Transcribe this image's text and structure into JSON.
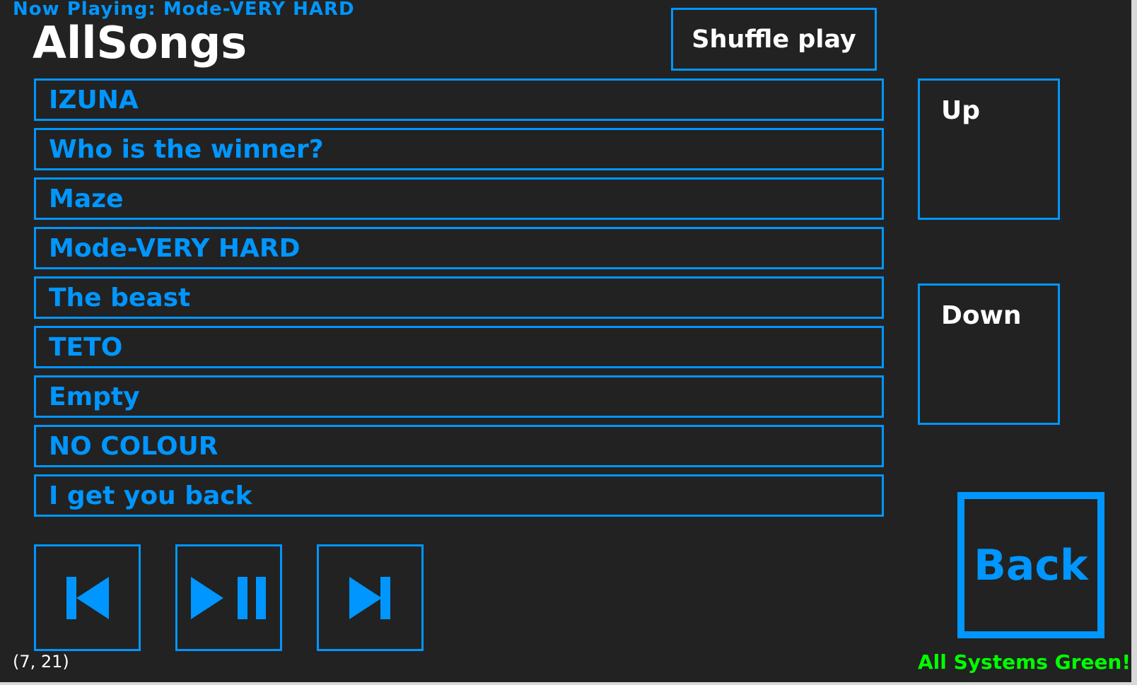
{
  "now_playing": "Now Playing: Mode-VERY HARD",
  "title": "AllSongs",
  "shuffle_label": "Shuffle play",
  "songs": [
    "IZUNA",
    "Who is the winner?",
    "Maze",
    "Mode-VERY HARD",
    "The beast",
    "TETO",
    "Empty",
    "NO COLOUR",
    "I get you back"
  ],
  "up_label": "Up",
  "down_label": "Down",
  "back_label": "Back",
  "coords": "(7, 21)",
  "status": "All Systems Green!",
  "colors": {
    "accent": "#0096ff",
    "background": "#222222",
    "status": "#00ff00"
  }
}
